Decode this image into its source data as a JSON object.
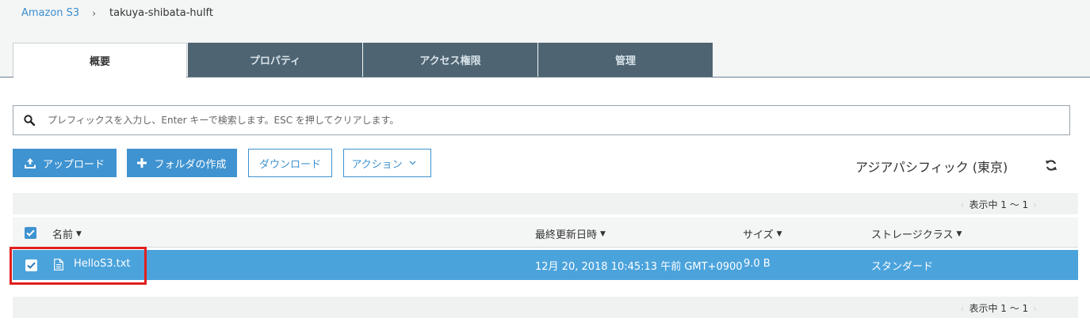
{
  "breadcrumb": {
    "root": "Amazon S3",
    "separator": "›",
    "current": "takuya-shibata-hulft"
  },
  "tabs": [
    {
      "label": "概要",
      "active": true
    },
    {
      "label": "プロパティ",
      "active": false
    },
    {
      "label": "アクセス権限",
      "active": false
    },
    {
      "label": "管理",
      "active": false
    }
  ],
  "search": {
    "placeholder": "プレフィックスを入力し、Enter キーで検索します。ESC を押してクリアします。",
    "value": ""
  },
  "toolbar": {
    "upload_label": "アップロード",
    "create_folder_label": "フォルダの作成",
    "download_label": "ダウンロード",
    "actions_label": "アクション"
  },
  "region": "アジアパシフィック (東京)",
  "pager_top": {
    "label": "表示中 1 ～ 1",
    "prev": "‹",
    "next": "›"
  },
  "pager_bottom": {
    "label": "表示中 1 ～ 1",
    "prev": "‹",
    "next": "›"
  },
  "table": {
    "columns": {
      "name": "名前",
      "modified": "最終更新日時",
      "size": "サイズ",
      "storage_class": "ストレージクラス"
    },
    "sort_caret": "▼",
    "rows": [
      {
        "name": "HelloS3.txt",
        "modified": "12月 20, 2018 10:45:13 午前 GMT+0900",
        "size": "9.0 B",
        "storage_class": "スタンダード",
        "selected": true
      }
    ]
  },
  "colors": {
    "accent": "#3f93d0",
    "tab_inactive": "#4e6472",
    "row_selected": "#4ba3dc",
    "highlight_box": "#e02020"
  }
}
